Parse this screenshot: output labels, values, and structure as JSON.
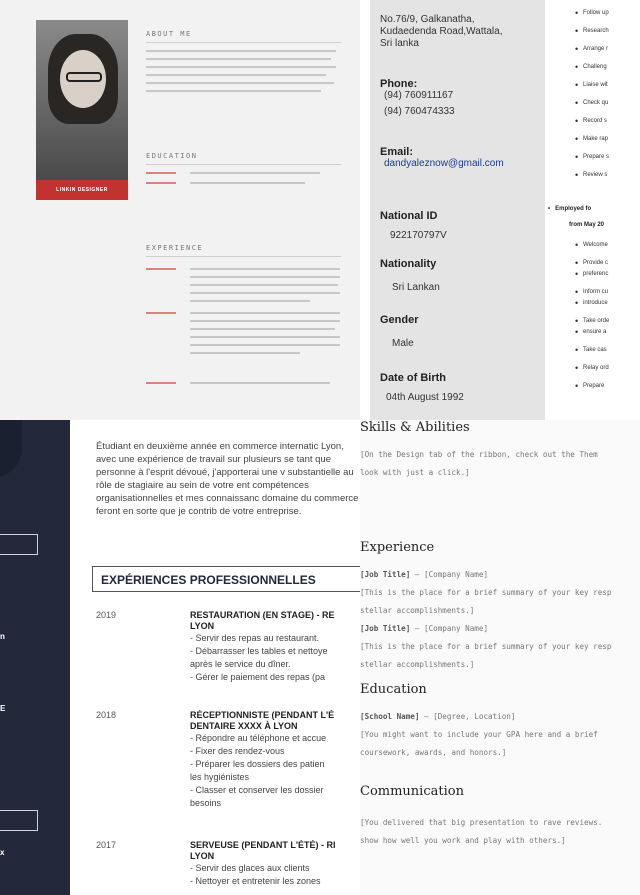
{
  "panel1": {
    "about_heading": "ABOUT ME",
    "education_heading": "EDUCATION",
    "experience_heading": "EXPERIENCE",
    "photo_banner": "LINKIN DESIGNER"
  },
  "panel2": {
    "address": [
      "No.76/9, Galkanatha,",
      "Kudaedenda Road,Wattala,",
      "Sri lanka"
    ],
    "phone_label": "Phone:",
    "phones": [
      "(94) 760911167",
      "(94) 760474333"
    ],
    "email_label": "Email:",
    "email": "dandyaleznow@gmail.com",
    "national_id_label": "National ID",
    "national_id": "922170797V",
    "nationality_label": "Nationality",
    "nationality": "Sri Lankan",
    "gender_label": "Gender",
    "gender": "Male",
    "dob_label": "Date of Birth",
    "dob": "04th August 1992",
    "duties_top": [
      "Follow up",
      "Research",
      "Arrange r",
      "Challeng",
      "Liaise wit",
      "Check qu",
      "Record s",
      "Make rap",
      "Prepare s",
      "Review s"
    ],
    "employed_line1": "Employed fo",
    "employed_line2": "from May 20",
    "duties_bottom": [
      "Welcome",
      "Provide c",
      "preferenc",
      "Inform cu",
      "introduce",
      "Take orde",
      "ensure a",
      "Take cas",
      "Relay ord",
      "Prepare"
    ]
  },
  "panel3": {
    "intro": "Étudiant en deuxième année en commerce internatic Lyon, avec une expérience de travail sur plusieurs se tant que personne à l'esprit dévoué, j'apporterai une v substantielle au rôle de stagiaire au sein de votre ent compétences organisationnelles et mes connaissanc domaine du commerce feront en sorte que je contrib de votre entreprise.",
    "section_title": "EXPÉRIENCES PROFESSIONNELLES",
    "jobs": [
      {
        "year": "2019",
        "title1": "RESTAURATION (EN STAGE) - RE",
        "title2": "LYON",
        "lines": [
          "- Servir des repas au restaurant.",
          "- Débarrasser les tables et nettoye",
          "après le service du dîner.",
          "- Gérer le paiement des repas (pa"
        ]
      },
      {
        "year": "2018",
        "title1": "RÉCEPTIONNISTE (PENDANT L'É",
        "title2": "DENTAIRE XXXX À LYON",
        "lines": [
          "- Répondre au téléphone et accue",
          "- Fixer des rendez-vous",
          "- Préparer les dossiers des patien",
          "les hygiénistes",
          "- Classer et conserver les dossier",
          "besoins"
        ]
      },
      {
        "year": "2017",
        "title1": "SERVEUSE (PENDANT L'ÉTÉ) - RI",
        "title2": "LYON",
        "lines": [
          "- Servir des glaces aux clients",
          "- Nettoyer et entretenir les zones"
        ]
      }
    ],
    "side_letters": [
      "n",
      "E",
      "x"
    ]
  },
  "panel4": {
    "skills_heading": "Skills & Abilities",
    "skills_text": [
      "[On the Design tab of the ribbon, check out the Them",
      "look with just a click.]"
    ],
    "experience_heading": "Experience",
    "exp_items": [
      {
        "title": "[Job Title]",
        "company": " – [Company Name]",
        "desc": [
          "[This is the place for a brief summary of your key resp",
          "stellar accomplishments.]"
        ]
      },
      {
        "title": "[Job Title]",
        "company": " – [Company Name]",
        "desc": [
          "[This is the place for a brief summary of your key resp",
          "stellar accomplishments.]"
        ]
      }
    ],
    "education_heading": "Education",
    "school": "[School Name]",
    "degree": " – [Degree, Location]",
    "edu_text": [
      "[You might want to include your GPA here and a brief",
      "coursework, awards, and honors.]"
    ],
    "communication_heading": "Communication",
    "comm_text": [
      "[You delivered that big presentation to rave reviews.",
      "show how well you work and play with others.]"
    ]
  }
}
